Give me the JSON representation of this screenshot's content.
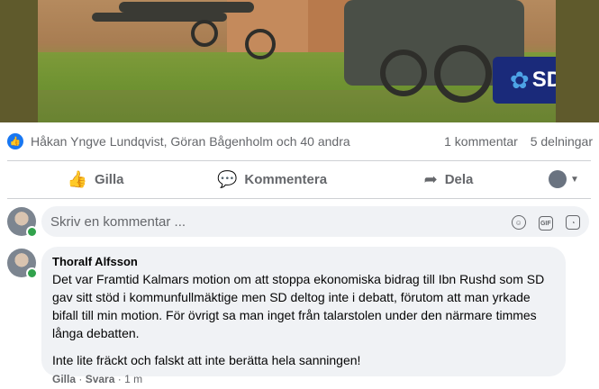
{
  "post": {
    "reactions_names": "Håkan Yngve Lundqvist, Göran Bågenholm och 40 andra",
    "comments_count": "1 kommentar",
    "shares_count": "5 delningar",
    "logo_text": "SD"
  },
  "actions": {
    "like": "Gilla",
    "comment": "Kommentera",
    "share": "Dela"
  },
  "composer": {
    "placeholder": "Skriv en kommentar ..."
  },
  "comment": {
    "author": "Thoralf Alfsson",
    "paragraph1": "Det var Framtid Kalmars motion om att stoppa ekonomiska bidrag till Ibn Rushd som SD gav sitt stöd i kommunfullmäktige men SD deltog inte i debatt, förutom att man yrkade bifall till min motion. För övrigt sa man inget från talarstolen under den närmare timmes långa debatten.",
    "paragraph2": "Inte lite fräckt och falskt att inte berätta hela sanningen!",
    "like": "Gilla",
    "reply": "Svara",
    "time": "1 m"
  },
  "colors": {
    "accent": "#1877f2",
    "bubble": "#f0f2f5",
    "secondary_text": "#65676b",
    "online": "#31a24c",
    "logo_bg": "#1a2a7a"
  }
}
